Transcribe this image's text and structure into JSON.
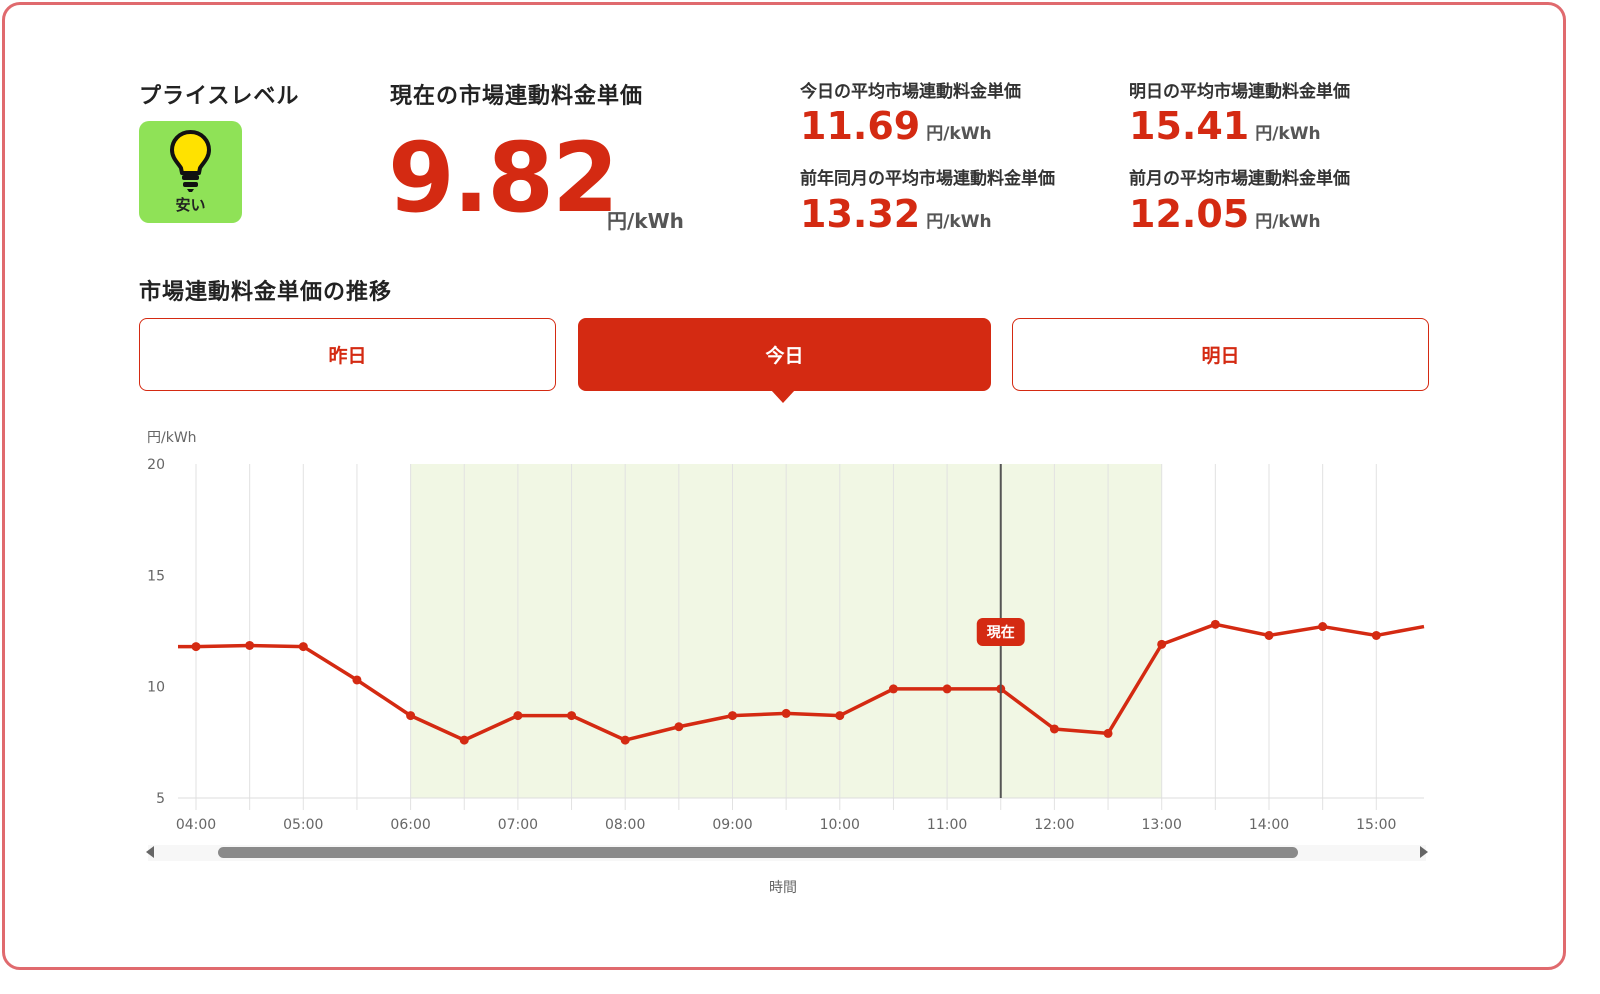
{
  "price_level": {
    "title": "プライスレベル",
    "badge_label": "安い",
    "badge_icon": "lightbulb-icon",
    "badge_color": "#8fe257"
  },
  "current": {
    "title": "現在の市場連動料金単価",
    "value": "9.82",
    "unit": "円/kWh"
  },
  "averages": {
    "today": {
      "label": "今日の平均市場連動料金単価",
      "value": "11.69",
      "unit": "円/kWh"
    },
    "tomorrow": {
      "label": "明日の平均市場連動料金単価",
      "value": "15.41",
      "unit": "円/kWh"
    },
    "same_month_last_year": {
      "label": "前年同月の平均市場連動料金単価",
      "value": "13.32",
      "unit": "円/kWh"
    },
    "last_month": {
      "label": "前月の平均市場連動料金単価",
      "value": "12.05",
      "unit": "円/kWh"
    }
  },
  "trend": {
    "title": "市場連動料金単価の推移",
    "tabs": [
      {
        "label": "昨日",
        "active": false
      },
      {
        "label": "今日",
        "active": true
      },
      {
        "label": "明日",
        "active": false
      }
    ]
  },
  "colors": {
    "accent": "#d42a12",
    "highlight_band": "#f1f7e4",
    "border": "#e06a6e"
  },
  "chart_data": {
    "type": "line",
    "ylabel": "円/kWh",
    "xlabel": "時間",
    "ylim": [
      5,
      20
    ],
    "yticks": [
      5,
      10,
      15,
      20
    ],
    "x_tick_labels": [
      "04:00",
      "05:00",
      "06:00",
      "07:00",
      "08:00",
      "09:00",
      "10:00",
      "11:00",
      "12:00",
      "13:00",
      "14:00",
      "15:00"
    ],
    "x": [
      "04:00",
      "04:30",
      "05:00",
      "05:30",
      "06:00",
      "06:30",
      "07:00",
      "07:30",
      "08:00",
      "08:30",
      "09:00",
      "09:30",
      "10:00",
      "10:30",
      "11:00",
      "11:30",
      "12:00",
      "12:30",
      "13:00",
      "13:30",
      "14:00",
      "14:30",
      "15:00"
    ],
    "values": [
      11.8,
      11.85,
      11.8,
      10.3,
      8.7,
      7.6,
      8.7,
      8.7,
      7.6,
      8.2,
      8.7,
      8.8,
      8.7,
      9.9,
      9.9,
      9.9,
      8.1,
      7.9,
      11.9,
      12.8,
      12.3,
      12.7,
      12.3
    ],
    "low_price_range": [
      "06:00",
      "13:00"
    ],
    "current_time": "11:30",
    "current_marker_label": "現在",
    "grid": true
  },
  "scrollbar": {
    "left_arrow": "left-triangle-icon",
    "right_arrow": "right-triangle-icon"
  }
}
